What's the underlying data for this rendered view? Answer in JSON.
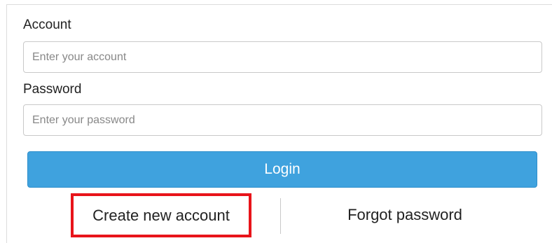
{
  "form": {
    "account_label": "Account",
    "account_placeholder": "Enter your account",
    "password_label": "Password",
    "password_placeholder": "Enter your password",
    "login_label": "Login",
    "create_account_label": "Create new account",
    "forgot_password_label": "Forgot password"
  },
  "colors": {
    "login_button": "#3fa2de",
    "highlight_box": "#e8141a"
  }
}
